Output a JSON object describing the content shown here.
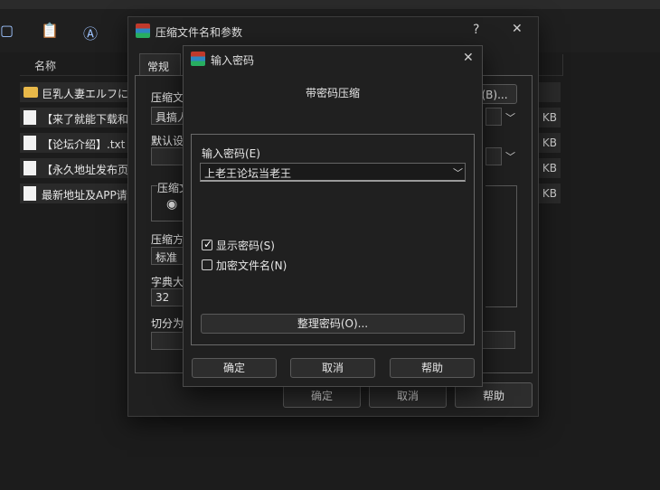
{
  "explorer": {
    "column_name": "名称",
    "files": [
      {
        "name": "巨乳人妻エルフに",
        "size": "",
        "type": "folder"
      },
      {
        "name": "【来了就能下载和",
        "size": "KB",
        "type": "doc"
      },
      {
        "name": "【论坛介绍】.txt",
        "size": "KB",
        "type": "doc"
      },
      {
        "name": "【永久地址发布页",
        "size": "KB",
        "type": "doc"
      },
      {
        "name": "最新地址及APP请",
        "size": "KB",
        "type": "doc"
      }
    ]
  },
  "main_dialog": {
    "title": "压缩文件名和参数",
    "help_glyph": "?",
    "close_glyph": "✕",
    "tab_general": "常规",
    "archive_label": "压缩文",
    "archive_value": "具搞人",
    "browse_label": "(B)...",
    "default_label": "默认设",
    "format_group": "压缩文",
    "method_label": "压缩方",
    "method_value": "标准",
    "dict_label": "字典大",
    "dict_value": "32",
    "split_label": "切分为",
    "ok": "确定",
    "cancel": "取消",
    "help": "帮助"
  },
  "password_dialog": {
    "title": "输入密码",
    "close_glyph": "✕",
    "heading": "带密码压缩",
    "input_label": "输入密码(E)",
    "password_value": "上老王论坛当老王",
    "show_password_label": "显示密码(S)",
    "show_password_checked": true,
    "encrypt_names_label": "加密文件名(N)",
    "encrypt_names_checked": false,
    "manage_button": "整理密码(O)...",
    "ok": "确定",
    "cancel": "取消",
    "help": "帮助"
  }
}
